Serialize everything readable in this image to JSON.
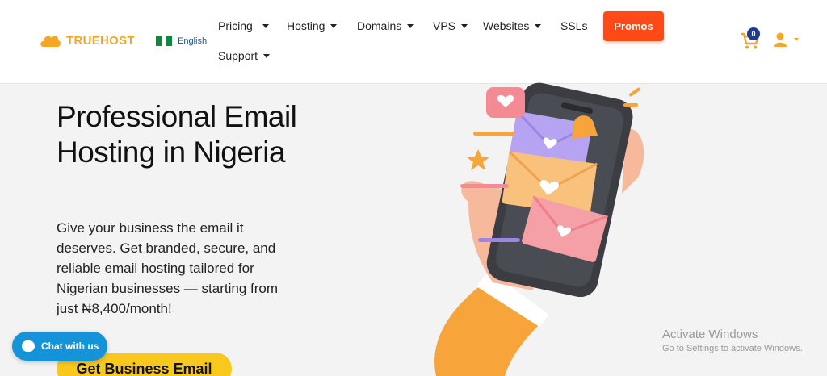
{
  "brand": {
    "name": "TRUEHOST",
    "color": "#f5a623"
  },
  "language": {
    "label": "English",
    "flag": "nigeria-flag"
  },
  "nav": {
    "pricing": "Pricing",
    "hosting": "Hosting",
    "domains": "Domains",
    "vps": "VPS",
    "websites": "Websites",
    "ssls": "SSLs",
    "support": "Support",
    "promos": "Promos"
  },
  "cart": {
    "count": "0",
    "icon": "cart-icon"
  },
  "user": {
    "icon": "user-icon"
  },
  "hero": {
    "title": "Professional Email Hosting in Nigeria",
    "text": "Give your business the email it deserves. Get branded, secure, and reliable email hosting tailored for Nigerian businesses — starting from just ₦8,400/month!",
    "cta": "Get Business Email"
  },
  "chat": {
    "label": "Chat with us"
  },
  "watermark": {
    "title": "Activate Windows",
    "subtitle": "Go to Settings to activate Windows."
  },
  "colors": {
    "promo": "#ff4a17",
    "cta": "#f9c81c",
    "chat": "#1593d8",
    "accent": "#f5a623"
  }
}
